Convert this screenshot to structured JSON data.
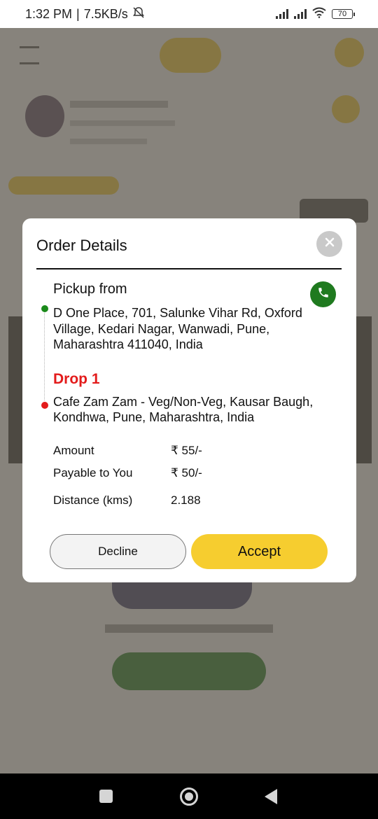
{
  "status_bar": {
    "time": "1:32 PM",
    "separator": "|",
    "speed": "7.5KB/s",
    "battery": "70"
  },
  "modal": {
    "title": "Order Details",
    "pickup_label": "Pickup from",
    "pickup_address": "D One Place, 701, Salunke Vihar Rd, Oxford Village, Kedari Nagar, Wanwadi, Pune, Maharashtra 411040, India",
    "drop_label": "Drop 1",
    "drop_address": "Cafe Zam Zam - Veg/Non-Veg, Kausar Baugh, Kondhwa, Pune, Maharashtra, India",
    "details": [
      {
        "label": "Amount",
        "value": "₹ 55/-"
      },
      {
        "label": "Payable to You",
        "value": "₹ 50/-"
      },
      {
        "label": "Distance (kms)",
        "value": "2.188"
      }
    ],
    "decline_label": "Decline",
    "accept_label": "Accept"
  },
  "colors": {
    "accent_yellow": "#f6cd2f",
    "call_green": "#1f7a1f",
    "drop_red": "#e31b1b"
  },
  "icons": {
    "close": "close-icon",
    "phone": "phone-icon",
    "pickup_marker": "pickup-dot-icon",
    "drop_marker": "drop-dot-icon"
  }
}
